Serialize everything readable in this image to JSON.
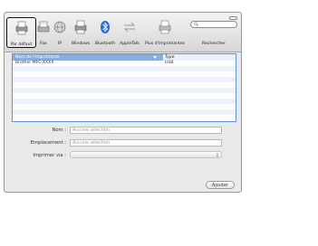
{
  "toolbar": {
    "items": [
      {
        "label": "Par défaut",
        "icon": "default-printer-icon",
        "selected": true
      },
      {
        "label": "Fax",
        "icon": "fax-icon"
      },
      {
        "label": "IP",
        "icon": "ip-globe-icon"
      },
      {
        "label": "Windows",
        "icon": "windows-printer-icon"
      },
      {
        "label": "Bluetooth",
        "icon": "bluetooth-icon"
      },
      {
        "label": "AppleTalk",
        "icon": "appletalk-icon"
      },
      {
        "label": "Plus d'imprimantes",
        "icon": "more-printers-icon"
      }
    ],
    "search_label": "Rechercher",
    "search_placeholder": ""
  },
  "list": {
    "columns": [
      "Nom de l'imprimante",
      "Type"
    ],
    "rows": [
      {
        "name": "Brother MFC-XXXX",
        "type": "USB"
      }
    ]
  },
  "form": {
    "name_label": "Nom :",
    "name_value": "Aucune sélection",
    "location_label": "Emplacement :",
    "location_value": "Aucune sélection",
    "print_via_label": "Imprimer via :",
    "print_via_value": ""
  },
  "add_button": "Ajouter",
  "colors": {
    "selection_blue": "#89aedb",
    "list_border": "#5f93d8",
    "bluetooth": "#2a6bd6"
  }
}
